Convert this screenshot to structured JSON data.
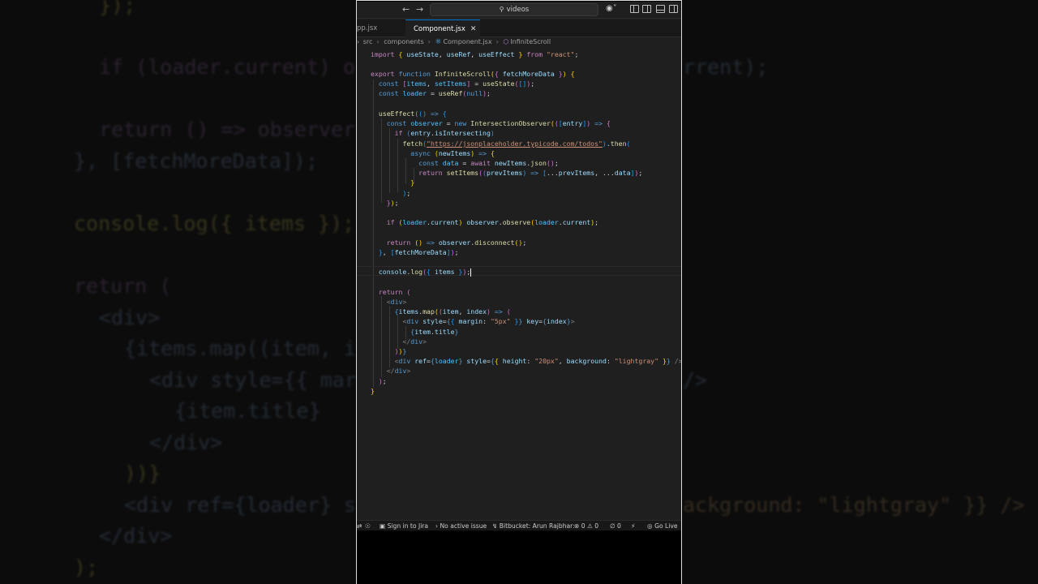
{
  "background_code": [
    "});",
    "if (loader.current) o",
    "return () => observer",
    "}, [fetchMoreData]);",
    "console.log({ items });",
    "return (",
    "<div>",
    "{items.map((item, i",
    "<div style={{ mar",
    "{item.title}",
    "</div>",
    "))}",
    "<div ref={loader} s",
    "</div>",
    ");"
  ],
  "background_right": [
    "rrent);",
    "ackground: \"lightgray\" }} />",
    "/>"
  ],
  "titlebar": {
    "back_icon": "arrow-left-icon",
    "forward_icon": "arrow-right-icon",
    "search_text": "videos"
  },
  "tabs": [
    {
      "label": "pp.jsx",
      "active": false
    },
    {
      "label": "Component.jsx",
      "active": true
    }
  ],
  "breadcrumb": [
    "src",
    "components",
    "Component.jsx",
    "InfiniteScroll"
  ],
  "code": [
    "import { useState, useRef, useEffect } from \"react\";",
    "",
    "export function InfiniteScroll({ fetchMoreData }) {",
    "  const [items, setItems] = useState([]);",
    "  const loader = useRef(null);",
    "",
    "  useEffect(() => {",
    "    const observer = new IntersectionObserver(([entry]) => {",
    "      if (entry.isIntersecting)",
    "        fetch(\"https://jsonplaceholder.typicode.com/todos\").then(",
    "          async (newItems) => {",
    "            const data = await newItems.json();",
    "            return setItems((prevItems) => [...prevItems, ...data]);",
    "          }",
    "        );",
    "    });",
    "",
    "    if (loader.current) observer.observe(loader.current);",
    "",
    "    return () => observer.disconnect();",
    "  }, [fetchMoreData]);",
    "",
    "  console.log({ items });",
    "",
    "  return (",
    "    <div>",
    "      {items.map((item, index) => (",
    "        <div style={{ margin: \"5px\" }} key={index}>",
    "          {item.title}",
    "        </div>",
    "      ))}",
    "      <div ref={loader} style={{ height: \"20px\", background: \"lightgray\" }} />",
    "    </div>",
    "  );",
    "}"
  ],
  "status": {
    "jira": "Sign in to Jira",
    "issue": "No active issue",
    "bitbucket": "Bitbucket: Arun Rajbhar:",
    "problems_errors": "0",
    "problems_warnings": "0",
    "ports": "0",
    "golive": "Go Live"
  },
  "colors": {
    "editor_bg": "#1f1f1f",
    "keyword": "#c586c0",
    "function": "#dcdcaa",
    "string": "#ce9178",
    "variable": "#9cdcfe"
  }
}
